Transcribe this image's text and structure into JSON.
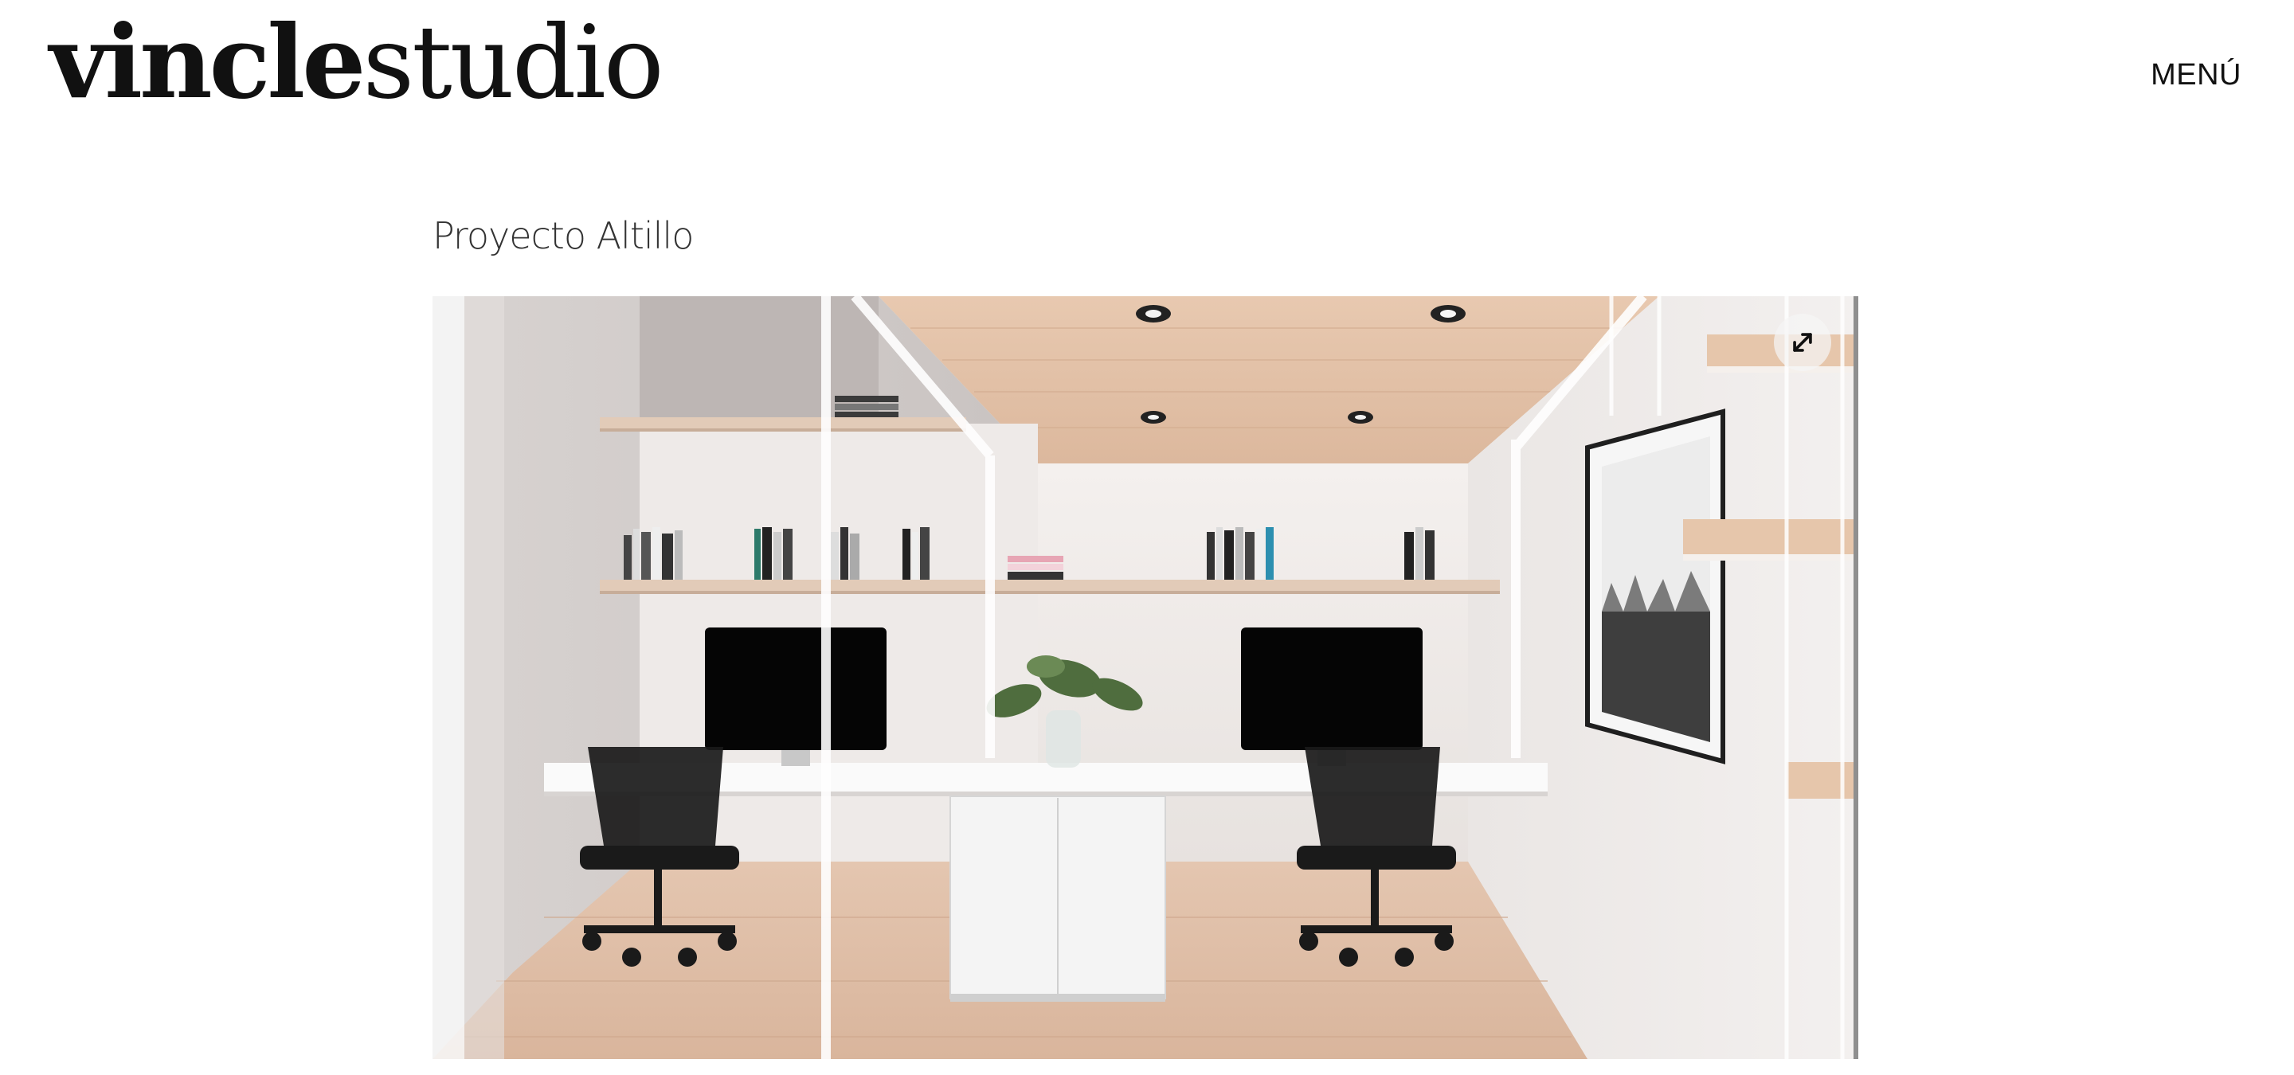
{
  "header": {
    "logo": {
      "bold_part": "vincle",
      "light_part": "studio"
    },
    "menu_label": "MENÚ"
  },
  "project": {
    "title": "Proyecto Altillo"
  },
  "gallery": {
    "expand_icon": "expand-arrows-icon"
  }
}
